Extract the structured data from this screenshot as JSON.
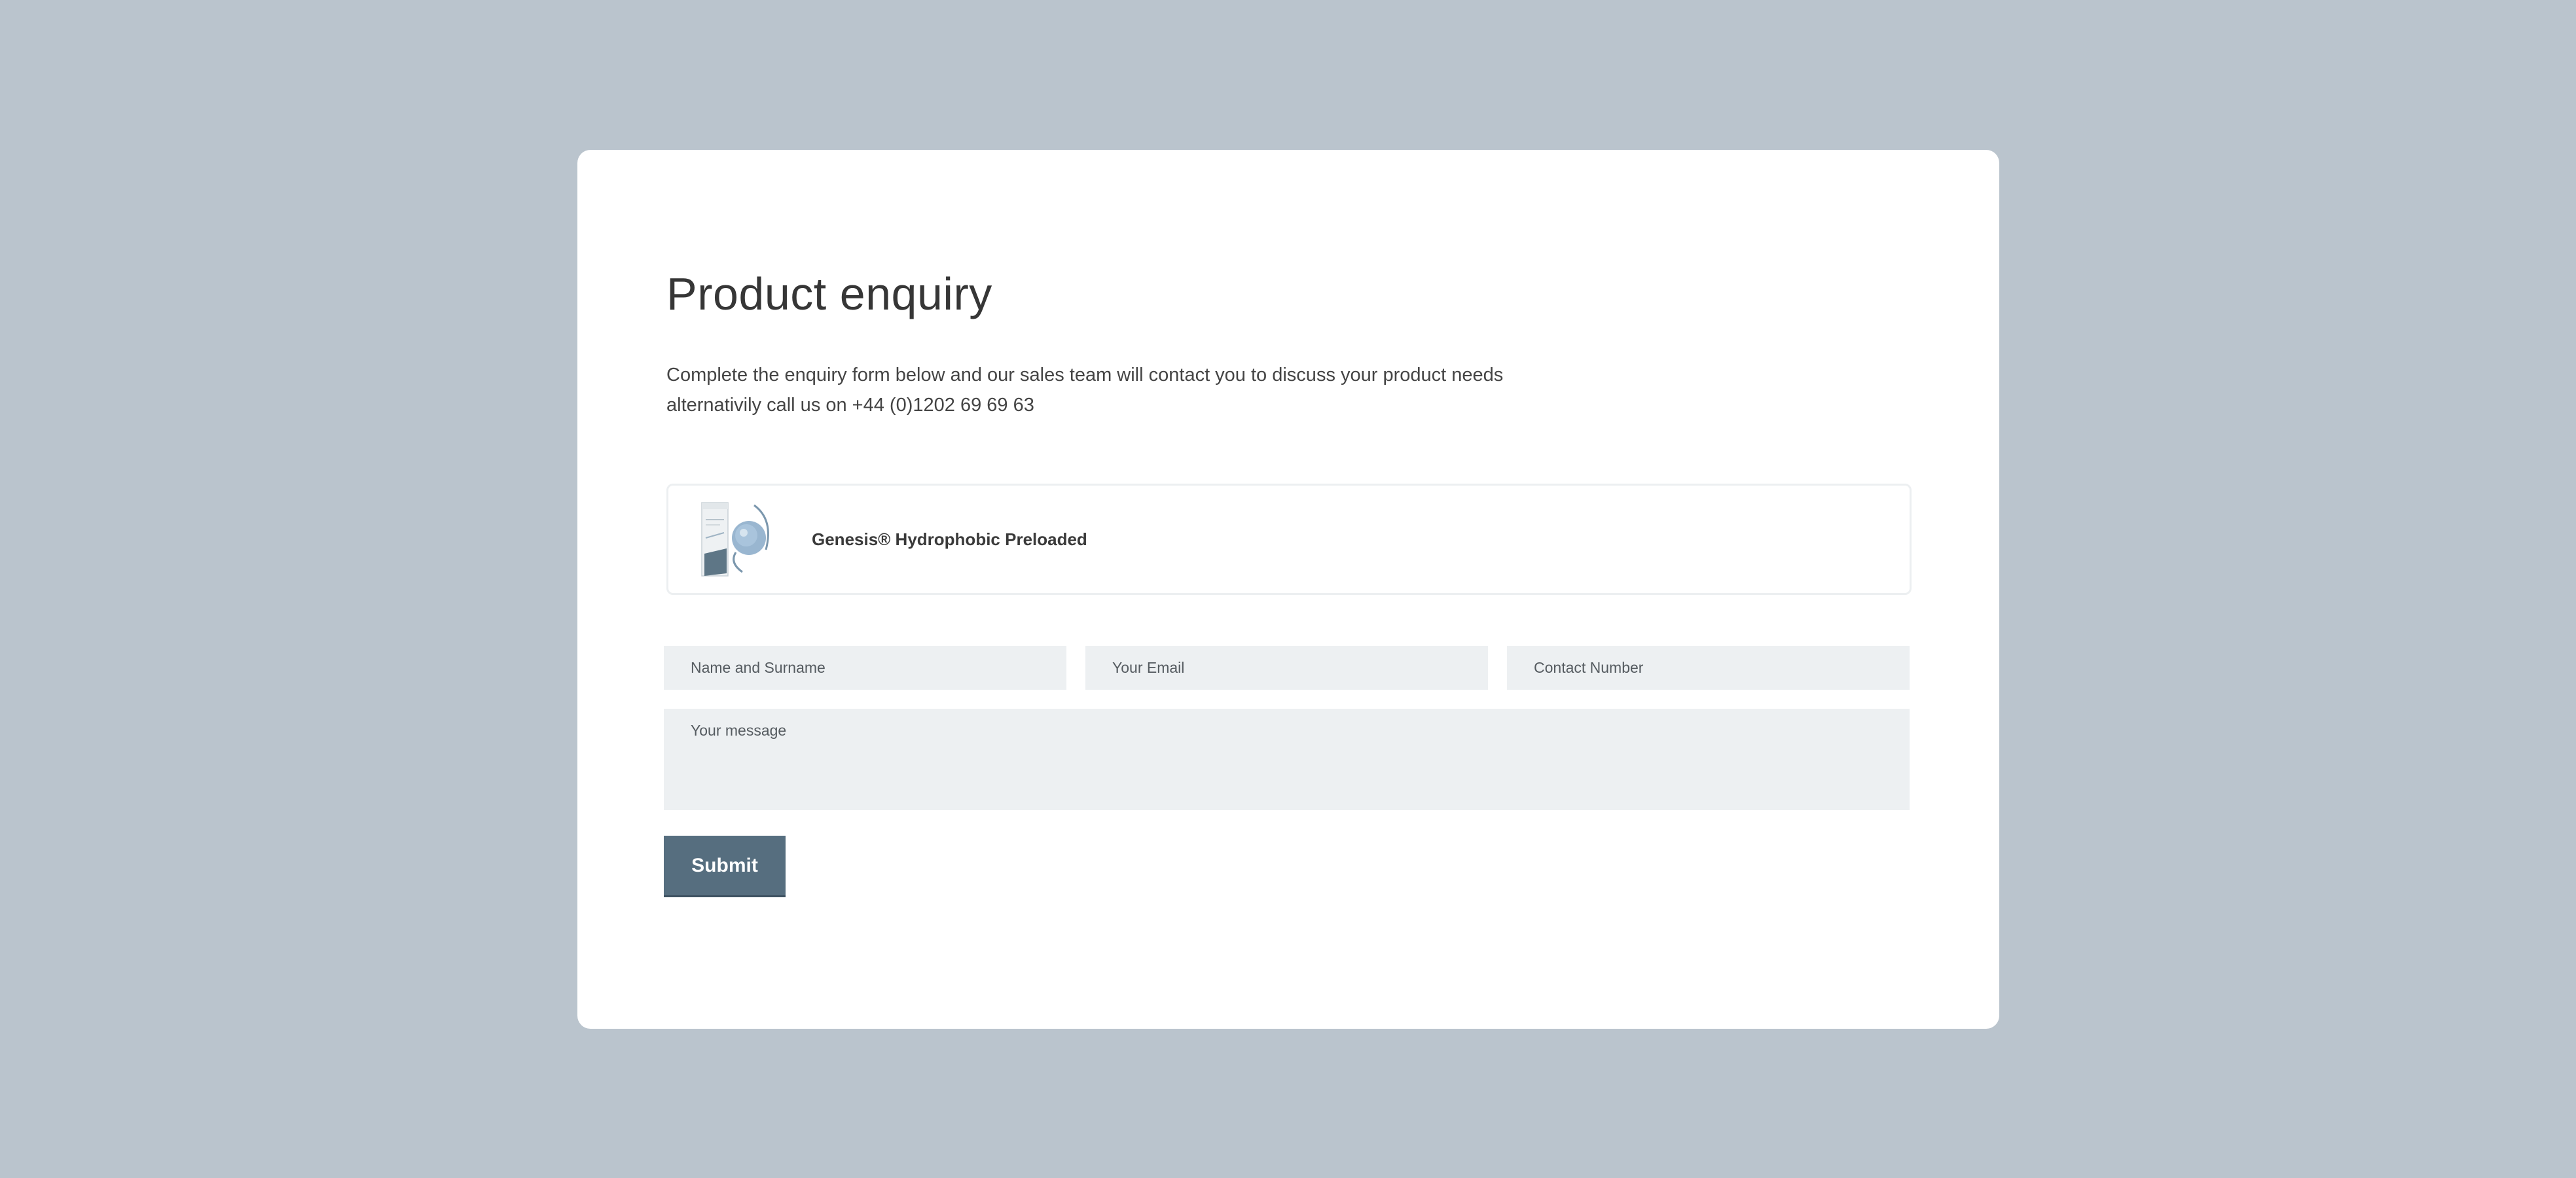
{
  "modal": {
    "title": "Product enquiry",
    "intro_line1": "Complete the enquiry form below and our sales team will contact you to discuss your product needs",
    "intro_line2": "alternativily call us on +44 (0)1202 69 69 63"
  },
  "product": {
    "name": "Genesis® Hydrophobic Preloaded",
    "image_icon": "product-box-lens-image"
  },
  "form": {
    "name_placeholder": "Name and Surname",
    "email_placeholder": "Your Email",
    "phone_placeholder": "Contact Number",
    "message_placeholder": "Your message",
    "submit_label": "Submit"
  },
  "colors": {
    "background": "#bac4cd",
    "card": "#ffffff",
    "field": "#edf0f2",
    "button": "#566e7f"
  }
}
